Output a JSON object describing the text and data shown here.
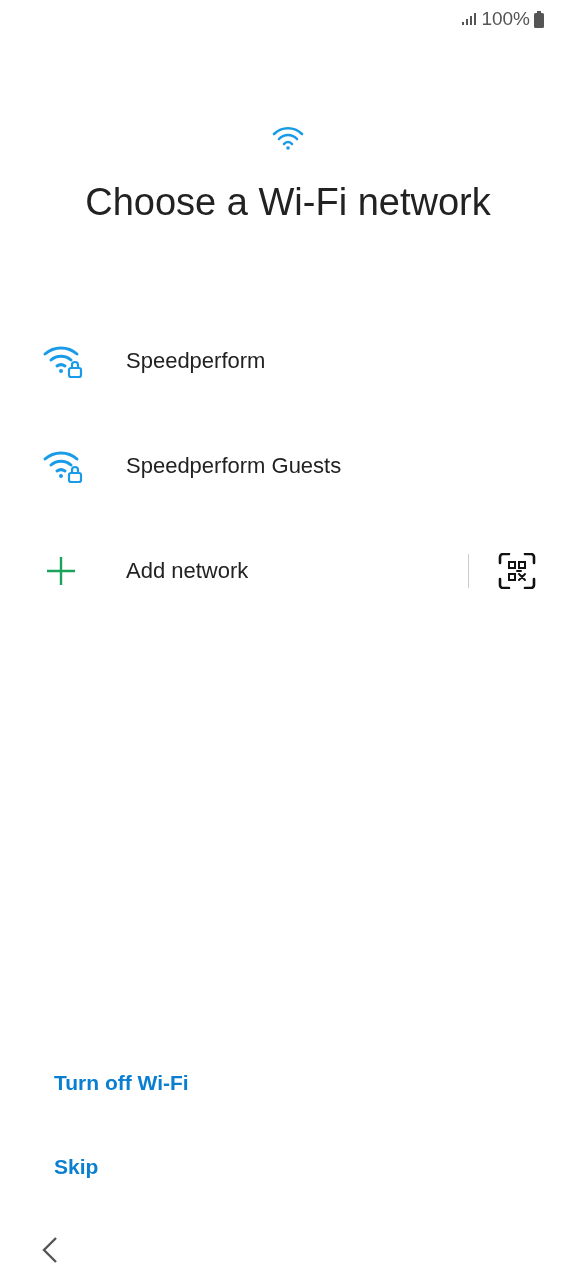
{
  "status_bar": {
    "battery": "100%"
  },
  "title": "Choose a Wi-Fi network",
  "networks": [
    {
      "kind": "wifi",
      "name": "Speedperform",
      "secured": true
    },
    {
      "kind": "wifi",
      "name": "Speedperform Guests",
      "secured": true
    },
    {
      "kind": "add",
      "name": "Add network"
    }
  ],
  "actions": [
    "Turn off Wi-Fi",
    "Skip"
  ]
}
